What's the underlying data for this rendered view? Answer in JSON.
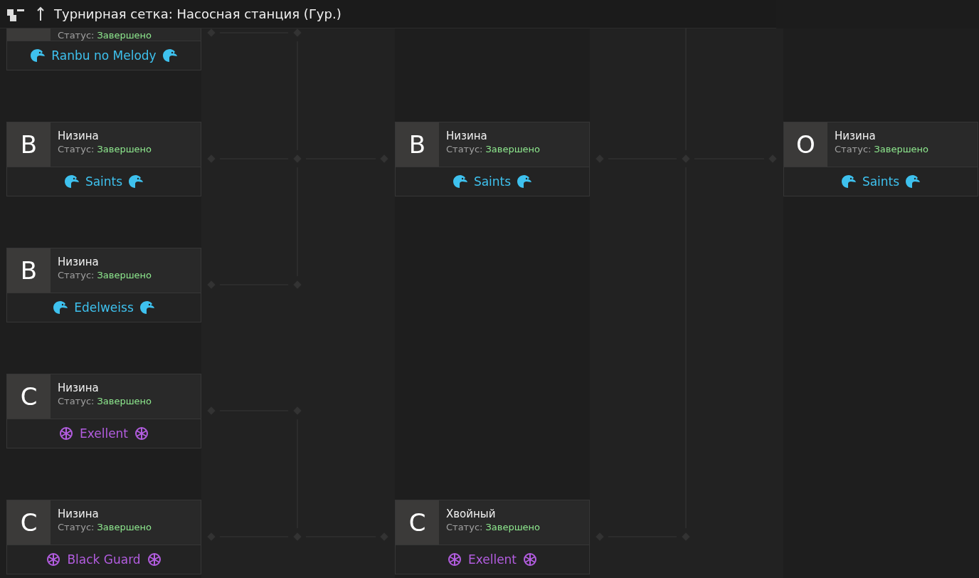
{
  "header": {
    "title": "Турнирная сетка: Насосная станция (Гур.)"
  },
  "rounds": [
    {
      "matches": [
        {
          "status_label": "Статус:",
          "status": "Завершено",
          "team": {
            "name": "Ranbu no Melody",
            "kind": "eagle",
            "color": "#3ec1ee"
          }
        },
        {
          "grade": "B",
          "location": "Низина",
          "status_label": "Статус:",
          "status": "Завершено",
          "team": {
            "name": "Saints",
            "kind": "eagle",
            "color": "#3ec1ee"
          }
        },
        {
          "grade": "B",
          "location": "Низина",
          "status_label": "Статус:",
          "status": "Завершено",
          "team": {
            "name": "Edelweiss",
            "kind": "eagle",
            "color": "#3ec1ee"
          }
        },
        {
          "grade": "C",
          "location": "Низина",
          "status_label": "Статус:",
          "status": "Завершено",
          "team": {
            "name": "Exellent",
            "kind": "wheel",
            "color": "#b35de0"
          }
        },
        {
          "grade": "C",
          "location": "Низина",
          "status_label": "Статус:",
          "status": "Завершено",
          "team": {
            "name": "Black Guard",
            "kind": "wheel",
            "color": "#b35de0"
          }
        }
      ]
    },
    {
      "matches": [
        {
          "grade": "B",
          "location": "Низина",
          "status_label": "Статус:",
          "status": "Завершено",
          "team": {
            "name": "Saints",
            "kind": "eagle",
            "color": "#3ec1ee"
          }
        },
        {
          "grade": "C",
          "location": "Хвойный",
          "status_label": "Статус:",
          "status": "Завершено",
          "team": {
            "name": "Exellent",
            "kind": "wheel",
            "color": "#b35de0"
          }
        }
      ]
    },
    {
      "matches": [
        {
          "grade": "O",
          "location": "Низина",
          "status_label": "Статус:",
          "status": "Завершено",
          "team": {
            "name": "Saints",
            "kind": "eagle",
            "color": "#3ec1ee"
          }
        }
      ]
    }
  ]
}
